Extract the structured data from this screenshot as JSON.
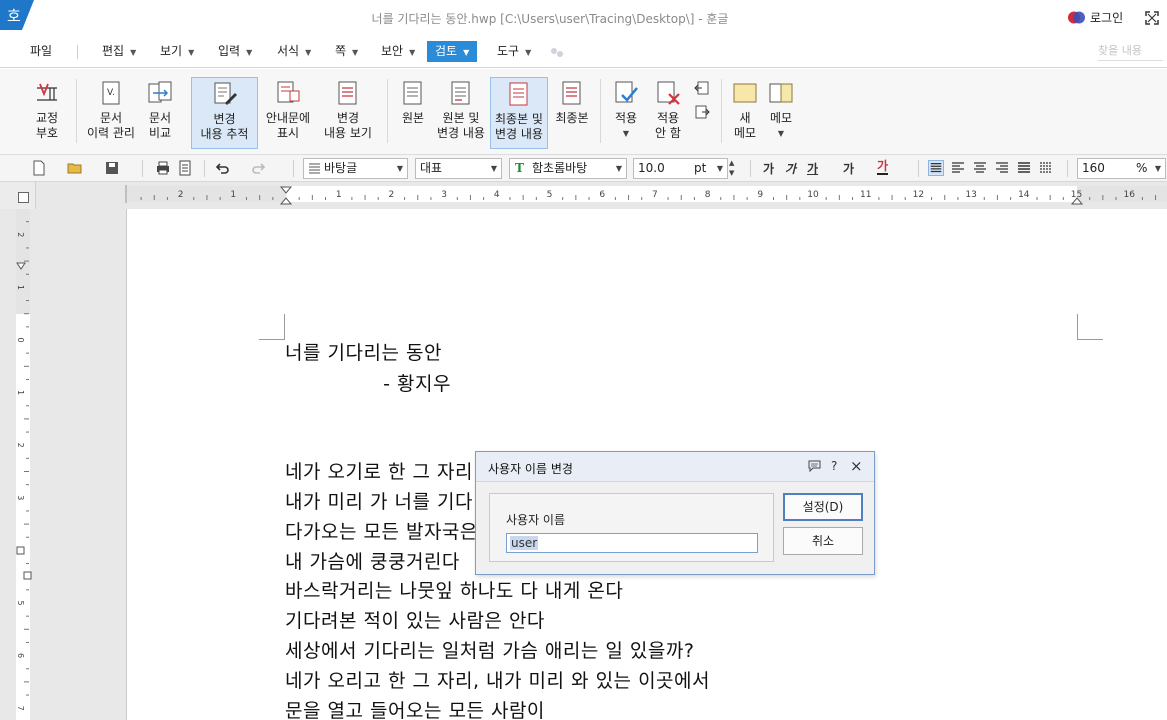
{
  "window": {
    "title": "너를 기다리는 동안.hwp [C:\\Users\\user\\Tracing\\Desktop\\] - 훈글",
    "app_logo": "호",
    "login_label": "로그인"
  },
  "menu": {
    "file": "파일",
    "items": [
      "편집",
      "보기",
      "입력",
      "서식",
      "쪽",
      "보안",
      "검토",
      "도구"
    ],
    "active": "검토",
    "search_placeholder": "찾을 내용"
  },
  "ribbon": {
    "proofread": "교정\n부호",
    "doc_history": "문서\n이력 관리",
    "doc_compare": "문서\n비교",
    "track_changes": "변경\n내용 추적",
    "show_guide": "안내문에\n표시",
    "view_changes": "변경\n내용 보기",
    "original": "원본",
    "original_and_changes": "원본 및\n변경 내용",
    "final_and_changes": "최종본 및\n변경 내용",
    "final": "최종본",
    "apply": "적용",
    "reject": "적용\n안 함",
    "new_memo": "새\n메모",
    "memo": "메모"
  },
  "format_bar": {
    "style": "바탕글",
    "outline": "대표",
    "font": "함초롬바탕",
    "font_size": "10.0",
    "size_unit": "pt",
    "bold_glyph": "가",
    "italic_glyph": "가",
    "underline_glyph": "가",
    "strike_glyph": "가",
    "color_glyph": "가",
    "zoom": "160",
    "zoom_unit": "%"
  },
  "ruler": {
    "h_ticks": [
      "2",
      "1",
      "1",
      "2",
      "3",
      "4",
      "5",
      "6",
      "7",
      "8",
      "9",
      "10",
      "11",
      "12",
      "13",
      "14",
      "15",
      "16"
    ],
    "v_ticks": [
      "2",
      "1",
      "0",
      "1",
      "2",
      "3",
      "4",
      "5",
      "6",
      "7"
    ]
  },
  "document": {
    "lines": [
      "너를 기다리는 동안",
      "               - 황지우",
      "",
      "네가 오기로 한 그 자리",
      "내가 미리 가 너를 기다",
      "다가오는 모든 발자국은",
      "내 가슴에 쿵쿵거린다",
      "바스락거리는 나뭇잎 하나도 다 내게 온다",
      "기다려본 적이 있는 사람은 안다",
      "세상에서 기다리는 일처럼 가슴 애리는 일 있을까?",
      "네가 오리고 한 그 자리, 내가 미리 와 있는 이곳에서",
      "문을 열고 들어오는 모든 사람이"
    ]
  },
  "dialog": {
    "title": "사용자 이름 변경",
    "field_label": "사용자 이름",
    "field_value": "user",
    "ok_button": "설정(D)",
    "cancel_button": "취소",
    "help_glyph": "?",
    "close_glyph": "×"
  }
}
